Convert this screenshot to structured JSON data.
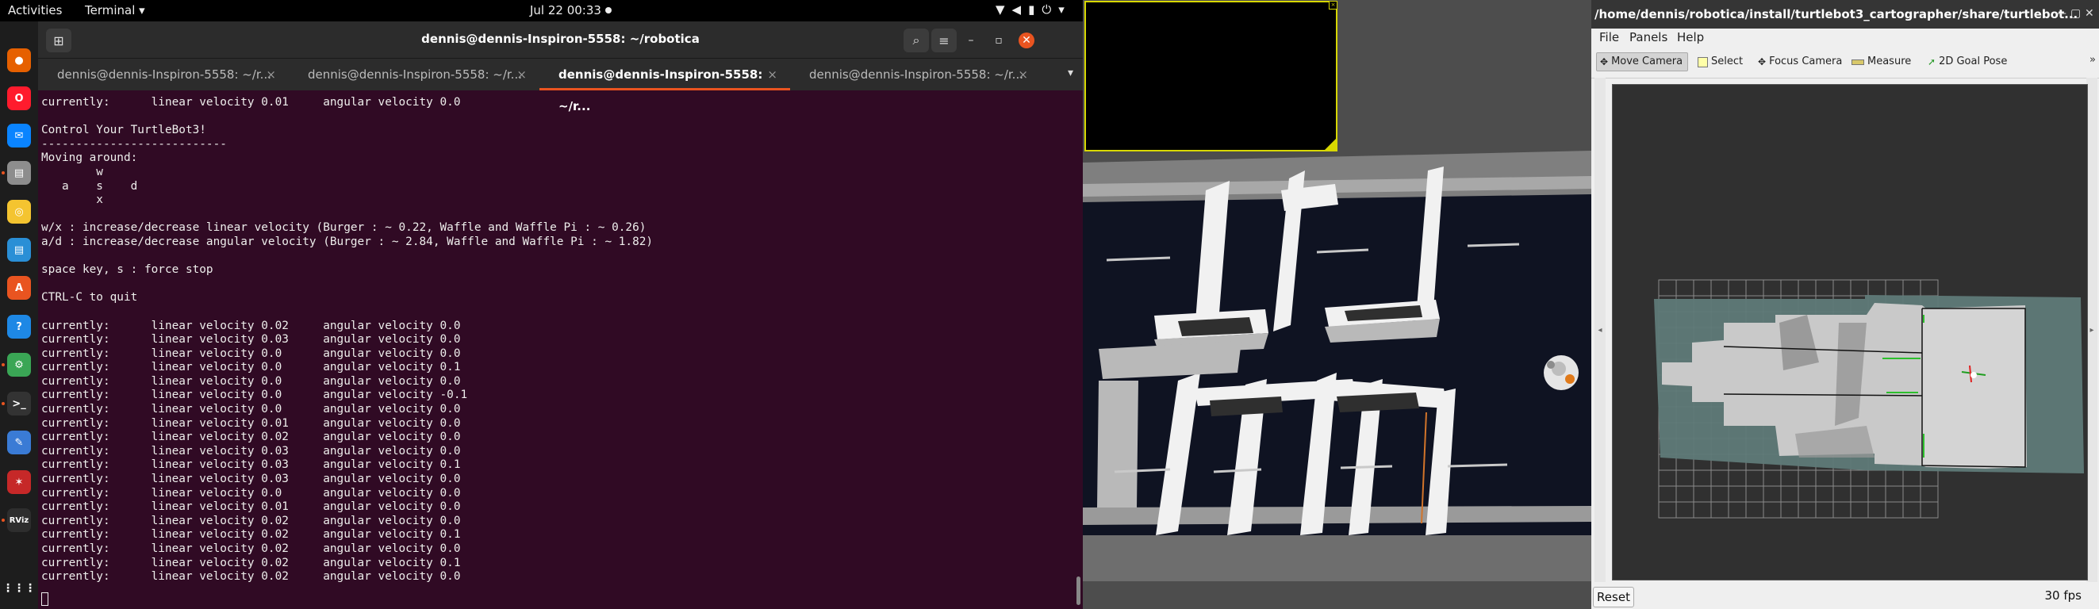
{
  "topbar": {
    "activities": "Activities",
    "app_menu": "Terminal ▾",
    "clock": "Jul 22  00:33"
  },
  "dock": {
    "items": [
      {
        "name": "firefox-icon",
        "color": "#e66000"
      },
      {
        "name": "opera-icon",
        "color": "#ff1b2d"
      },
      {
        "name": "thunderbird-icon",
        "color": "#0a84ff"
      },
      {
        "name": "files-icon",
        "color": "#8d8d8d"
      },
      {
        "name": "rhythmbox-icon",
        "color": "#f4c430"
      },
      {
        "name": "libreoffice-writer-icon",
        "color": "#2a8fd6"
      },
      {
        "name": "software-center-icon",
        "color": "#e95420"
      },
      {
        "name": "help-icon",
        "color": "#1e88e5"
      },
      {
        "name": "gazebo-icon",
        "color": "#3aa655"
      },
      {
        "name": "terminal-icon",
        "color": "#333333"
      },
      {
        "name": "text-editor-icon",
        "color": "#3a7bd5"
      },
      {
        "name": "ros-icon",
        "color": "#c62828"
      },
      {
        "name": "rviz-icon",
        "color": "#2e2e2e"
      }
    ],
    "rviz_label": "RViz",
    "apps_grid": "⋮⋮⋮"
  },
  "terminal": {
    "title": "dennis@dennis-Inspiron-5558: ~/robotica",
    "tabs": [
      {
        "label": "dennis@dennis-Inspiron-5558: ~/r...",
        "active": false
      },
      {
        "label": "dennis@dennis-Inspiron-5558: ~/r...",
        "active": false
      },
      {
        "label": "dennis@dennis-Inspiron-5558: ~/r...",
        "active": true
      },
      {
        "label": "dennis@dennis-Inspiron-5558: ~/r...",
        "active": false
      }
    ],
    "lines": [
      "currently:      linear velocity 0.01     angular velocity 0.0",
      "",
      "Control Your TurtleBot3!",
      "---------------------------",
      "Moving around:",
      "        w",
      "   a    s    d",
      "        x",
      "",
      "w/x : increase/decrease linear velocity (Burger : ~ 0.22, Waffle and Waffle Pi : ~ 0.26)",
      "a/d : increase/decrease angular velocity (Burger : ~ 2.84, Waffle and Waffle Pi : ~ 1.82)",
      "",
      "space key, s : force stop",
      "",
      "CTRL-C to quit",
      "",
      "currently:      linear velocity 0.02     angular velocity 0.0",
      "currently:      linear velocity 0.03     angular velocity 0.0",
      "currently:      linear velocity 0.0      angular velocity 0.0",
      "currently:      linear velocity 0.0      angular velocity 0.1",
      "currently:      linear velocity 0.0      angular velocity 0.0",
      "currently:      linear velocity 0.0      angular velocity -0.1",
      "currently:      linear velocity 0.0      angular velocity 0.0",
      "currently:      linear velocity 0.01     angular velocity 0.0",
      "currently:      linear velocity 0.02     angular velocity 0.0",
      "currently:      linear velocity 0.03     angular velocity 0.0",
      "currently:      linear velocity 0.03     angular velocity 0.1",
      "currently:      linear velocity 0.03     angular velocity 0.0",
      "currently:      linear velocity 0.0      angular velocity 0.0",
      "currently:      linear velocity 0.01     angular velocity 0.0",
      "currently:      linear velocity 0.02     angular velocity 0.0",
      "currently:      linear velocity 0.02     angular velocity 0.1",
      "currently:      linear velocity 0.02     angular velocity 0.0",
      "currently:      linear velocity 0.02     angular velocity 0.1",
      "currently:      linear velocity 0.02     angular velocity 0.0"
    ]
  },
  "rviz": {
    "title": "/home/dennis/robotica/install/turtlebot3_cartographer/share/turtlebot...",
    "menu": [
      "File",
      "Panels",
      "Help"
    ],
    "tools": [
      {
        "label": "Move Camera",
        "active": true
      },
      {
        "label": "Select",
        "active": false
      },
      {
        "label": "Focus Camera",
        "active": false
      },
      {
        "label": "Measure",
        "active": false
      },
      {
        "label": "2D Goal Pose",
        "active": false
      }
    ],
    "reset": "Reset",
    "fps": "30 fps"
  }
}
